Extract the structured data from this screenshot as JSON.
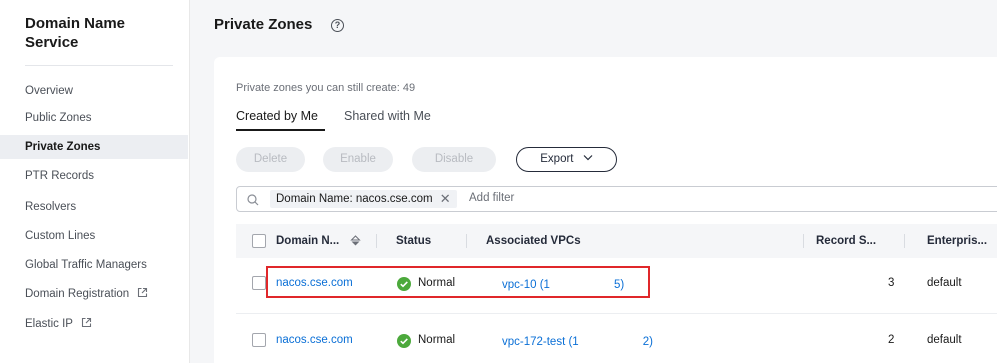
{
  "sidebar": {
    "title_line1": "Domain Name",
    "title_line2": "Service",
    "items": [
      {
        "label": "Overview"
      },
      {
        "label": "Public Zones"
      },
      {
        "label": "Private Zones",
        "active": true
      },
      {
        "label": "PTR Records"
      },
      {
        "label": "Resolvers"
      },
      {
        "label": "Custom Lines"
      },
      {
        "label": "Global Traffic Managers"
      },
      {
        "label": "Domain Registration",
        "external": true
      },
      {
        "label": "Elastic IP",
        "external": true
      }
    ]
  },
  "page": {
    "title": "Private Zones",
    "quota_text": "Private zones you can still create: 49",
    "tabs": [
      {
        "label": "Created by Me",
        "active": true
      },
      {
        "label": "Shared with Me"
      }
    ],
    "buttons": {
      "delete": "Delete",
      "enable": "Enable",
      "disable": "Disable",
      "export": "Export"
    },
    "filter": {
      "chip": "Domain Name: nacos.cse.com",
      "add_filter": "Add filter"
    }
  },
  "table": {
    "columns": {
      "domain": "Domain N...",
      "status": "Status",
      "vpcs": "Associated VPCs",
      "record_sets": "Record S...",
      "enterprise": "Enterpris..."
    },
    "rows": [
      {
        "domain": "nacos.cse.com",
        "status": "Normal",
        "vpc_prefix": "vpc-10 (1",
        "vpc_suffix": "5)",
        "record_sets": "3",
        "enterprise": "default",
        "highlighted": true
      },
      {
        "domain": "nacos.cse.com",
        "status": "Normal",
        "vpc_prefix": "vpc-172-test (1",
        "vpc_suffix": "2)",
        "record_sets": "2",
        "enterprise": "default"
      }
    ]
  },
  "colors": {
    "link": "#0a6fd6",
    "status_normal": "#4ca93c",
    "highlight_border": "#e0272a"
  }
}
